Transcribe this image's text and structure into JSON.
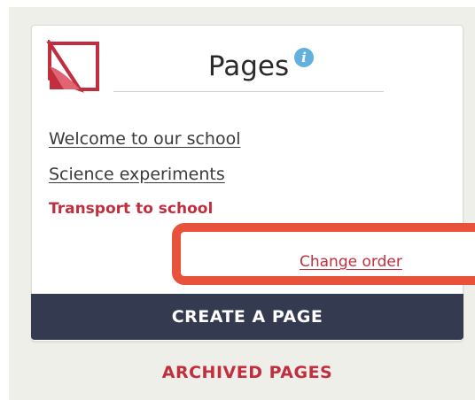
{
  "widget": {
    "title": "Pages",
    "info_icon_glyph": "i",
    "logo_icon": "red-folded-flag-logo",
    "accent_color": "#c12f3e",
    "info_color": "#62b0de"
  },
  "pages": [
    {
      "label": "Welcome to our school"
    },
    {
      "label": "Science experiments"
    }
  ],
  "current_page": {
    "label": "Transport to school"
  },
  "change_order_label": "Change order",
  "create_button_label": "CREATE A PAGE",
  "archived_label": "ARCHIVED PAGES",
  "annotation_color": "#e8523a"
}
